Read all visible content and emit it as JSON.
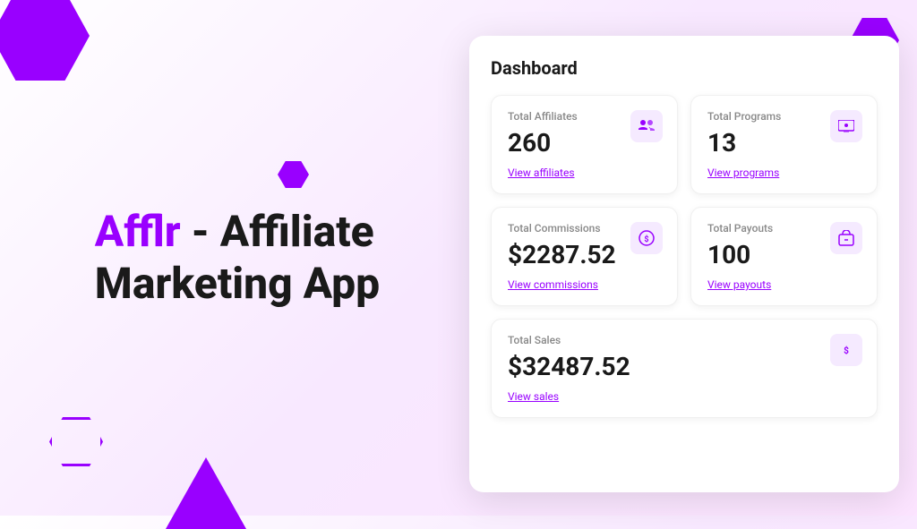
{
  "hero": {
    "brand": "Afflr",
    "title_rest": " - Affiliate\nMarketing App"
  },
  "dashboard": {
    "title": "Dashboard",
    "cards": [
      {
        "id": "affiliates",
        "label": "Total Affiliates",
        "value": "260",
        "link_text": "View affiliates",
        "icon": "👥",
        "wide": false
      },
      {
        "id": "programs",
        "label": "Total Programs",
        "value": "13",
        "link_text": "View programs",
        "icon": "🖥️",
        "wide": false
      },
      {
        "id": "commissions",
        "label": "Total Commissions",
        "value": "$2287.52",
        "link_text": "View commissions",
        "icon": "💰",
        "wide": false
      },
      {
        "id": "payouts",
        "label": "Total Payouts",
        "value": "100",
        "link_text": "View payouts",
        "icon": "🛒",
        "wide": false
      },
      {
        "id": "sales",
        "label": "Total Sales",
        "value": "$32487.52",
        "link_text": "View sales",
        "icon": "💲",
        "wide": true
      }
    ]
  }
}
